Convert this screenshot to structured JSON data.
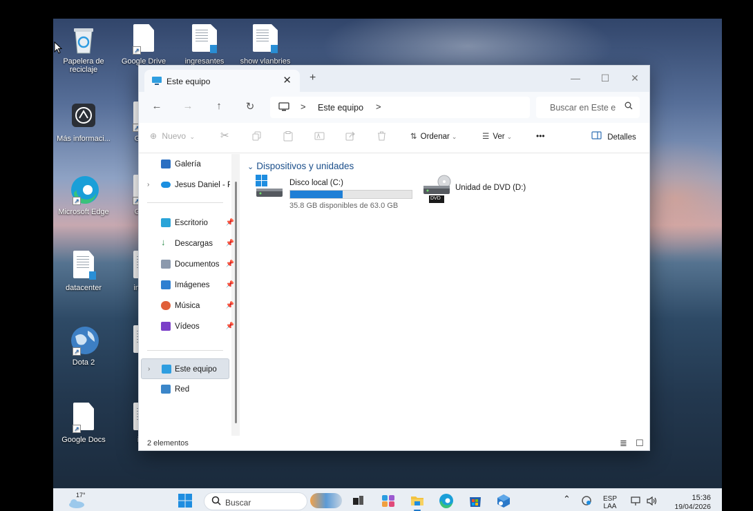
{
  "desktop": {
    "icons": [
      {
        "label": "Papelera de reciclaje"
      },
      {
        "label": "Google Drive"
      },
      {
        "label": "ingresantes"
      },
      {
        "label": "show vlanbries"
      },
      {
        "label": "Más informaci..."
      },
      {
        "label": "Goog"
      },
      {
        "label": "Microsoft Edge"
      },
      {
        "label": "Goog"
      },
      {
        "label": "datacenter"
      },
      {
        "label": "in cop"
      },
      {
        "label": "Dota 2"
      },
      {
        "label": "ind"
      },
      {
        "label": "Google Docs"
      },
      {
        "label": "ingr"
      }
    ]
  },
  "explorer": {
    "tab_title": "Este equipo",
    "tab_close": "✕",
    "new_tab": "+",
    "window_controls": {
      "minimize": "—",
      "maximize": "☐",
      "close": "✕"
    },
    "nav": {
      "back": "←",
      "forward": "→",
      "up": "↑",
      "refresh": "↻"
    },
    "address": {
      "separator": ">",
      "crumb": "Este equipo",
      "trailing": ">"
    },
    "search_placeholder": "Buscar en Este e",
    "toolbar": {
      "new_label": "Nuevo",
      "sort_label": "Ordenar",
      "view_label": "Ver",
      "more_label": "•••",
      "details_label": "Detalles"
    },
    "sidebar": {
      "items": [
        {
          "label": "Galería",
          "pinned": false
        },
        {
          "label": "Jesus Daniel - Pe",
          "pinned": false
        },
        {
          "label": "Escritorio",
          "pinned": true
        },
        {
          "label": "Descargas",
          "pinned": true
        },
        {
          "label": "Documentos",
          "pinned": true
        },
        {
          "label": "Imágenes",
          "pinned": true
        },
        {
          "label": "Música",
          "pinned": true
        },
        {
          "label": "Vídeos",
          "pinned": true
        },
        {
          "label": "Este equipo",
          "pinned": false
        },
        {
          "label": "Red",
          "pinned": false
        }
      ]
    },
    "content": {
      "group_header": "Dispositivos y unidades",
      "drives": [
        {
          "name": "Disco local (C:)",
          "free_text": "35.8 GB disponibles de 63.0 GB",
          "used_fraction": 0.43
        },
        {
          "name": "Unidad de DVD (D:)",
          "badge": "DVD"
        }
      ]
    },
    "status": {
      "count": "2 elementos"
    }
  },
  "taskbar": {
    "weather_temp": "17°",
    "search_text": "Buscar",
    "language_top": "ESP",
    "language_bottom": "LAA",
    "time": "15:36",
    "date": "19/04/2026"
  },
  "colors": {
    "accent": "#1f7fd6",
    "group_header": "#1a4e8a"
  }
}
